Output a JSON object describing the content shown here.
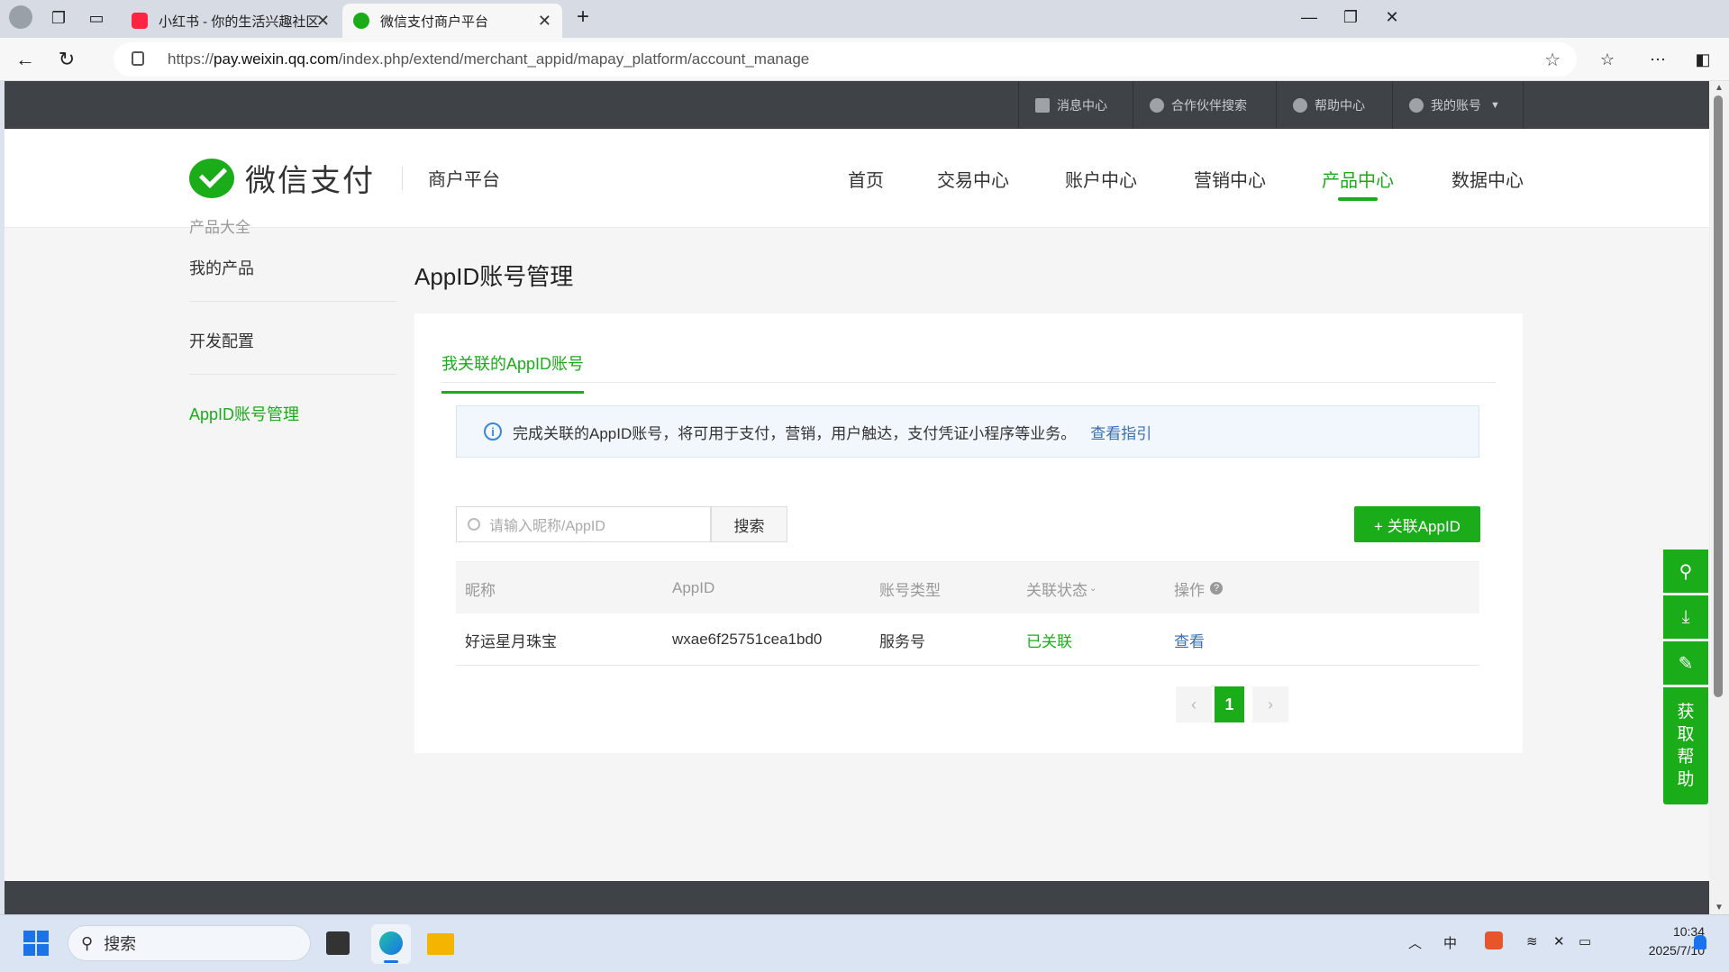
{
  "browser": {
    "tabs": [
      {
        "title": "小红书 - 你的生活兴趣社区",
        "icon": "xiaohongshu-icon",
        "color": "#ff2442"
      },
      {
        "title": "微信支付商户平台",
        "icon": "wechat-pay-icon",
        "color": "#1aad19"
      }
    ],
    "url_prefix": "https://",
    "url_host": "pay.weixin.qq.com",
    "url_path": "/index.php/extend/merchant_appid/mapay_platform/account_manage"
  },
  "topbar": {
    "links": [
      "消息中心",
      "合作伙伴搜索",
      "帮助中心",
      "我的账号"
    ]
  },
  "header": {
    "logo_text": "微信支付",
    "sub_title": "商户平台",
    "nav": [
      "首页",
      "交易中心",
      "账户中心",
      "营销中心",
      "产品中心",
      "数据中心"
    ],
    "active_nav": "产品中心",
    "brand_color": "#1aad19"
  },
  "sidebar": {
    "section_title": "产品大全",
    "items": [
      "我的产品",
      "开发配置",
      "AppID账号管理"
    ],
    "active_item": "AppID账号管理"
  },
  "main": {
    "title": "AppID账号管理",
    "tab": "我关联的AppID账号",
    "notice_text": "完成关联的AppID账号，将可用于支付，营销，用户触达，支付凭证小程序等业务。",
    "notice_link": "查看指引",
    "search_placeholder": "请输入昵称/AppID",
    "search_button": "搜索",
    "add_button": "+ 关联AppID",
    "table": {
      "columns": [
        "昵称",
        "AppID",
        "账号类型",
        "关联状态",
        "操作"
      ],
      "rows": [
        {
          "nickname": "好运星月珠宝",
          "appid": "wxae6f25751cea1bd0",
          "type": "服务号",
          "status": "已关联",
          "action": "查看"
        }
      ]
    },
    "pagination": {
      "prev": "‹",
      "current": "1",
      "next": "›"
    }
  },
  "float_help": {
    "label": "获取帮助",
    "chars": [
      "获",
      "取",
      "帮",
      "助"
    ]
  },
  "taskbar": {
    "search_label": "搜索",
    "time": "10:34",
    "date": "2025/7/10"
  }
}
